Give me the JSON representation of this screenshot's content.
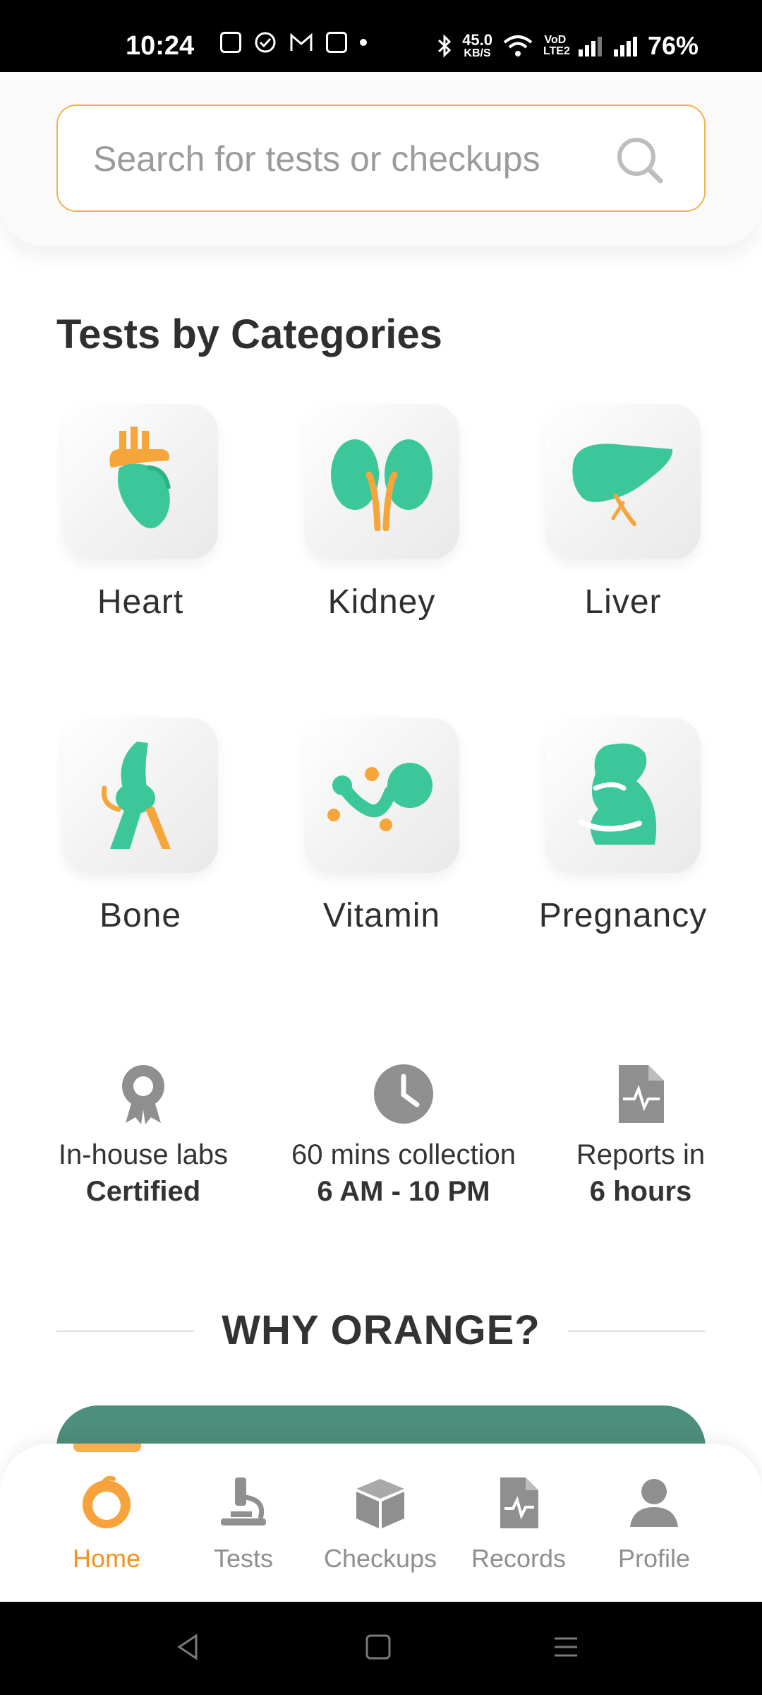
{
  "status_bar": {
    "time": "10:24",
    "net_speed_value": "45.0",
    "net_speed_unit": "KB/S",
    "volte": "VoD LTE2",
    "battery": "76%"
  },
  "search": {
    "placeholder": "Search for tests or checkups"
  },
  "categories_section": {
    "title": "Tests by Categories",
    "items": [
      {
        "label": "Heart",
        "icon": "heart-icon"
      },
      {
        "label": "Kidney",
        "icon": "kidney-icon"
      },
      {
        "label": "Liver",
        "icon": "liver-icon"
      },
      {
        "label": "Bone",
        "icon": "bone-icon"
      },
      {
        "label": "Vitamin",
        "icon": "vitamin-icon"
      },
      {
        "label": "Pregnancy",
        "icon": "pregnancy-icon"
      }
    ]
  },
  "features": [
    {
      "line1": "In-house labs",
      "line2": "Certified",
      "icon": "certified-badge-icon"
    },
    {
      "line1": "60 mins collection",
      "line2": "6 AM - 10 PM",
      "icon": "clock-icon"
    },
    {
      "line1": "Reports in",
      "line2": "6 hours",
      "icon": "report-icon"
    }
  ],
  "why_section": {
    "title": "WHY ORANGE?"
  },
  "bottom_nav": {
    "items": [
      {
        "label": "Home",
        "icon": "orange-home-icon",
        "active": true
      },
      {
        "label": "Tests",
        "icon": "microscope-icon",
        "active": false
      },
      {
        "label": "Checkups",
        "icon": "box-icon",
        "active": false
      },
      {
        "label": "Records",
        "icon": "record-file-icon",
        "active": false
      },
      {
        "label": "Profile",
        "icon": "person-icon",
        "active": false
      }
    ]
  },
  "colors": {
    "accent": "#f2931e",
    "search_border": "#f3b24a",
    "teal": "#3cc79a",
    "card_green": "#4e8e7c"
  }
}
